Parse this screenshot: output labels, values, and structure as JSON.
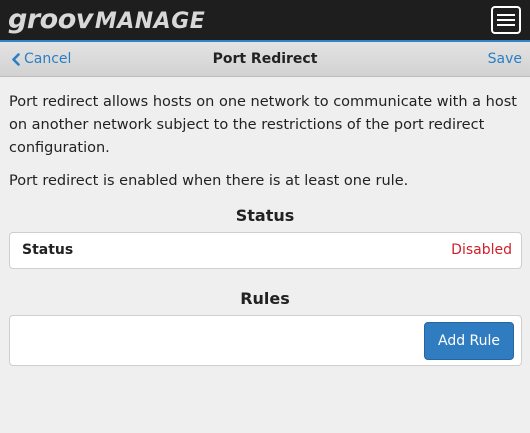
{
  "header": {
    "logo_text_primary": "groov",
    "logo_text_secondary": "MANAGE",
    "menu_icon": "hamburger-menu-icon"
  },
  "navbar": {
    "cancel_label": "Cancel",
    "cancel_icon": "chevron-left-icon",
    "title": "Port Redirect",
    "save_label": "Save",
    "accent_color": "#2a7fc4"
  },
  "description": {
    "paragraph_1": "Port redirect allows hosts on one network to communicate with a host on another network subject to the restrictions of the port redirect configuration.",
    "paragraph_2": "Port redirect is enabled when there is at least one rule."
  },
  "status_section": {
    "heading": "Status",
    "label": "Status",
    "value": "Disabled",
    "value_color": "#d0202a"
  },
  "rules_section": {
    "heading": "Rules",
    "add_button_label": "Add Rule",
    "button_color": "#2f7dc0"
  }
}
